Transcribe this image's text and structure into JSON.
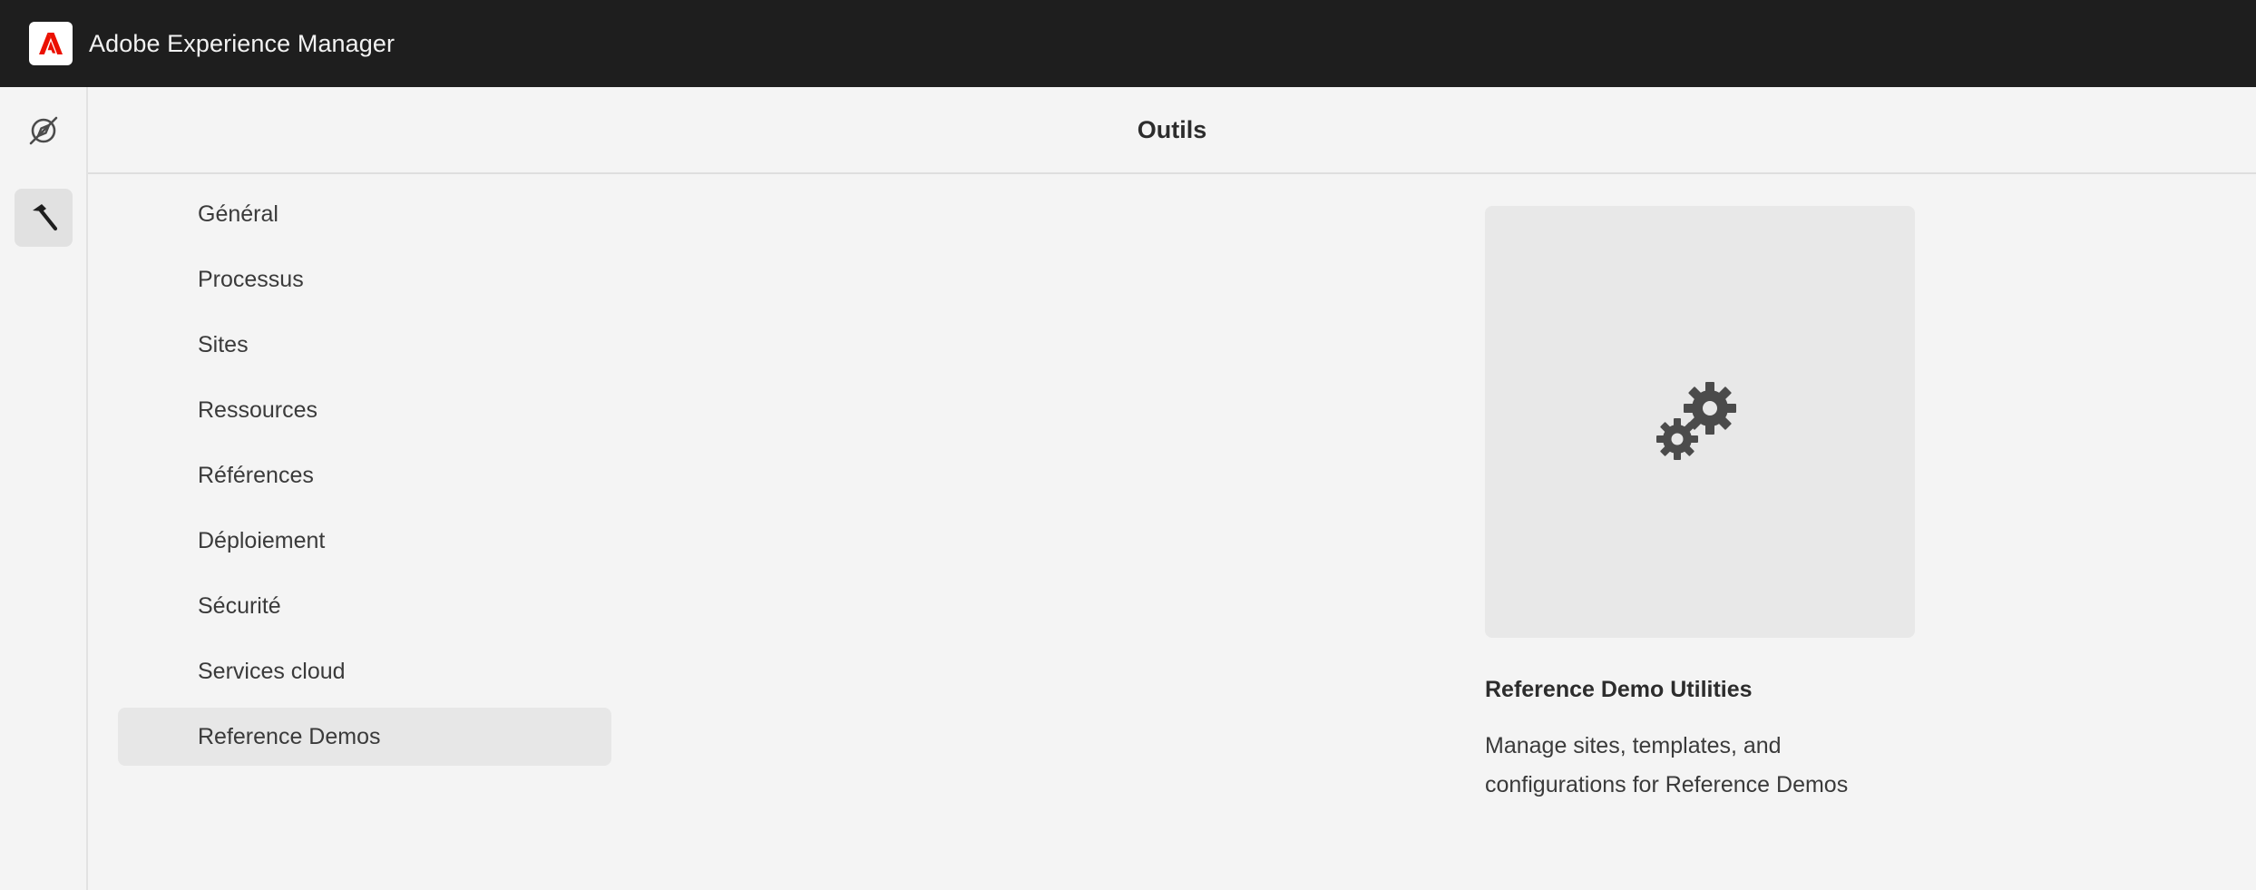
{
  "app": {
    "title": "Adobe Experience Manager",
    "logo_icon": "adobe-logo-icon",
    "brand_color": "#eb1000"
  },
  "rail": {
    "items": [
      {
        "icon": "navigation-compass-icon",
        "selected": false
      },
      {
        "icon": "hammer-tools-icon",
        "selected": true
      }
    ]
  },
  "header": {
    "title": "Outils"
  },
  "nav": {
    "items": [
      {
        "label": "Général",
        "selected": false
      },
      {
        "label": "Processus",
        "selected": false
      },
      {
        "label": "Sites",
        "selected": false
      },
      {
        "label": "Ressources",
        "selected": false
      },
      {
        "label": "Références",
        "selected": false
      },
      {
        "label": "Déploiement",
        "selected": false
      },
      {
        "label": "Sécurité",
        "selected": false
      },
      {
        "label": "Services cloud",
        "selected": false
      },
      {
        "label": "Reference Demos",
        "selected": true
      }
    ]
  },
  "card": {
    "icon": "gears-icon",
    "title": "Reference Demo Utilities",
    "description_line1": "Manage sites, templates, and",
    "description_line2": "configurations for Reference Demos"
  },
  "colors": {
    "topbar": "#1e1e1e",
    "background": "#f4f4f4",
    "selected": "#e7e7e7"
  }
}
